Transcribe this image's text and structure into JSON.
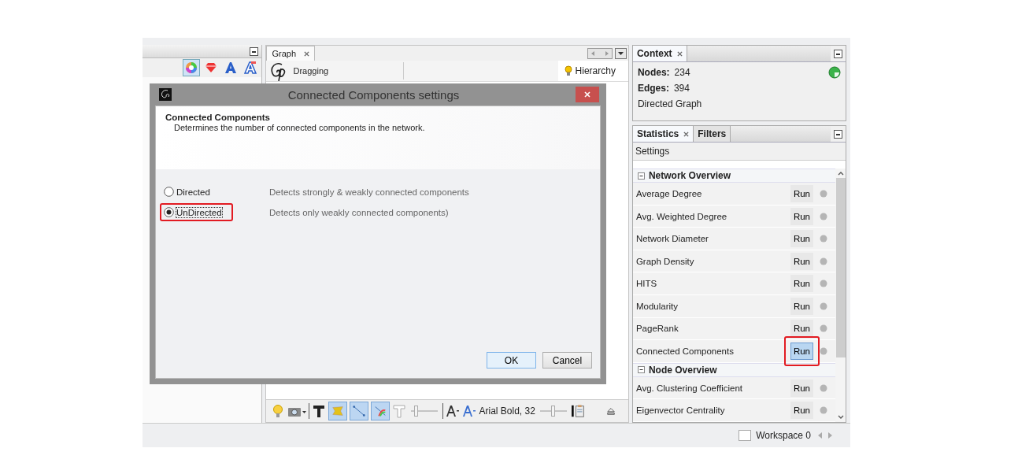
{
  "graph_panel": {
    "tab": {
      "label": "Graph",
      "selected": true
    },
    "tool_label": "Dragging",
    "hierarchy": "Hierarchy",
    "font_label": "Arial Bold, 32",
    "size_slider": {
      "level": 0.2
    },
    "font_size_slider": {
      "level": 0.5
    }
  },
  "context": {
    "tab": "Context",
    "nodes_label": "Nodes:",
    "nodes": "234",
    "edges_label": "Edges:",
    "edges": "394",
    "graph_type": "Directed Graph"
  },
  "statistics": {
    "tabs": [
      {
        "label": "Statistics",
        "selected": true
      },
      {
        "label": "Filters",
        "selected": false
      }
    ],
    "settings": "Settings",
    "groups": [
      {
        "title": "Network Overview",
        "expanded": true,
        "rows": [
          {
            "name": "Average Degree",
            "run": "Run",
            "highlighted": false
          },
          {
            "name": "Avg. Weighted Degree",
            "run": "Run",
            "highlighted": false
          },
          {
            "name": "Network Diameter",
            "run": "Run",
            "highlighted": false
          },
          {
            "name": "Graph Density",
            "run": "Run",
            "highlighted": false
          },
          {
            "name": "HITS",
            "run": "Run",
            "highlighted": false
          },
          {
            "name": "Modularity",
            "run": "Run",
            "highlighted": false
          },
          {
            "name": "PageRank",
            "run": "Run",
            "highlighted": false
          },
          {
            "name": "Connected Components",
            "run": "Run",
            "highlighted": true
          }
        ]
      },
      {
        "title": "Node Overview",
        "expanded": true,
        "rows": [
          {
            "name": "Avg. Clustering Coefficient",
            "run": "Run",
            "highlighted": false
          },
          {
            "name": "Eigenvector Centrality",
            "run": "Run",
            "highlighted": false
          }
        ]
      }
    ]
  },
  "status_bar": {
    "workspace": "Workspace 0"
  },
  "dialog": {
    "title": "Connected Components settings",
    "heading": "Connected Components",
    "description": "Determines the number of connected components in the network.",
    "options": [
      {
        "label": "Directed",
        "description": "Detects strongly & weakly connected components",
        "selected": false,
        "highlighted": false
      },
      {
        "label": "UnDirected",
        "description": "Detects only weakly connected components)",
        "selected": true,
        "highlighted": true
      }
    ],
    "buttons": [
      {
        "label": "OK",
        "default": true
      },
      {
        "label": "Cancel",
        "default": false
      }
    ]
  }
}
